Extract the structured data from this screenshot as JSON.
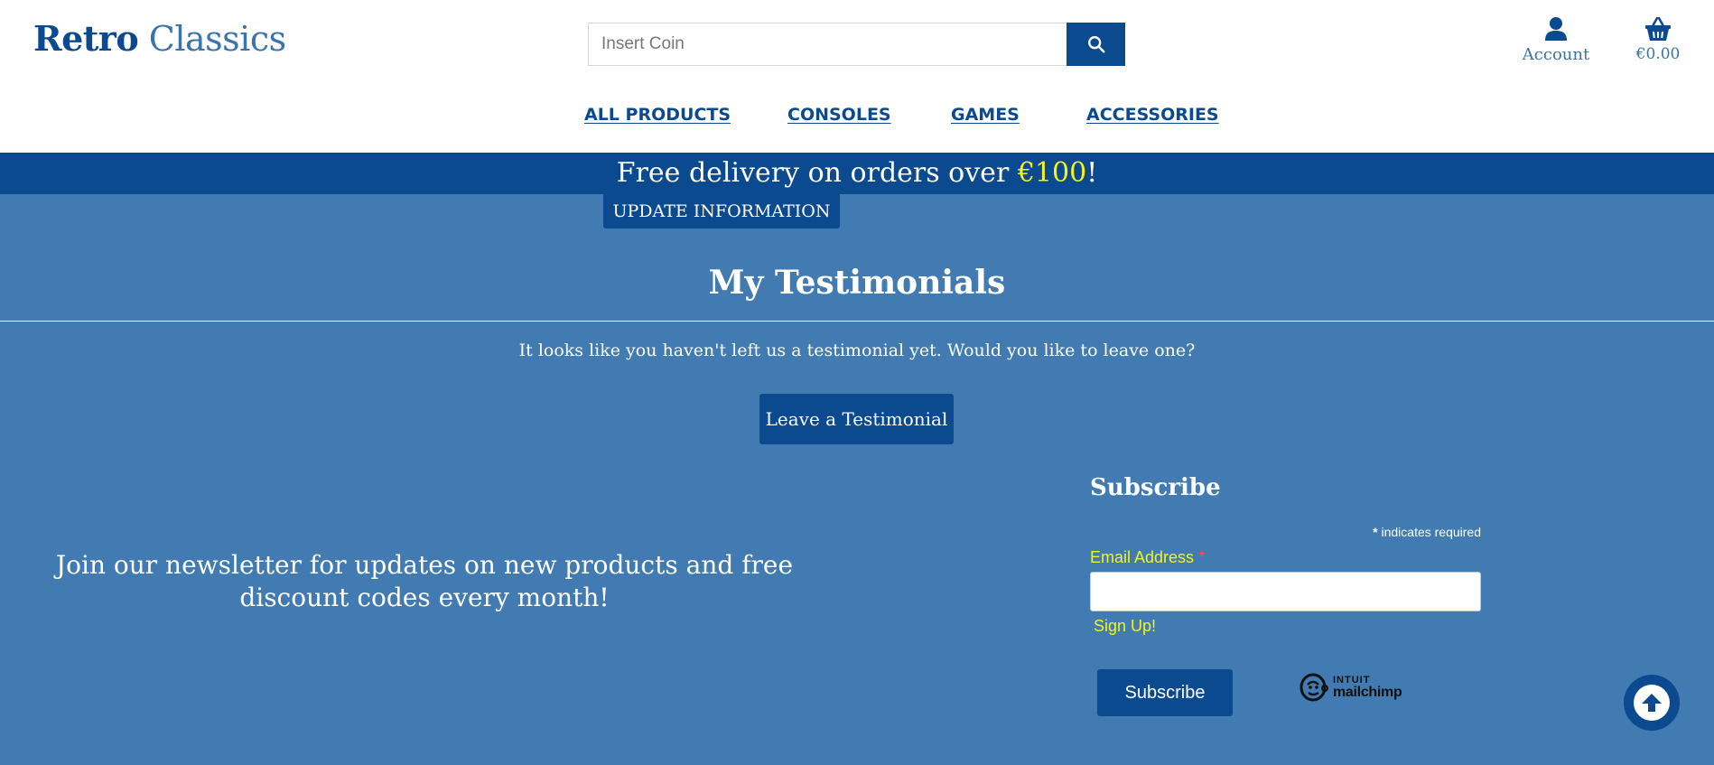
{
  "header": {
    "logo_bold": "Retro",
    "logo_light": "Classics",
    "search_placeholder": "Insert Coin",
    "account_label": "Account",
    "cart_total": "€0.00"
  },
  "nav": {
    "items": [
      {
        "label": "ALL PRODUCTS"
      },
      {
        "label": "CONSOLES"
      },
      {
        "label": "GAMES"
      },
      {
        "label": "ACCESSORIES"
      }
    ]
  },
  "banner": {
    "prefix": "Free delivery on orders over ",
    "amount": "€100",
    "suffix": "!"
  },
  "profile": {
    "update_button": "UPDATE INFORMATION"
  },
  "testimonials": {
    "title": "My Testimonials",
    "notice": "It looks like you haven't left us a testimonial yet. Would you like to leave one?",
    "button": "Leave a Testimonial"
  },
  "newsletter": {
    "text": "Join our newsletter for updates on new products and free discount codes every month!",
    "subscribe_title": "Subscribe",
    "required_star": "*",
    "required_note": " indicates required",
    "email_label": "Email Address ",
    "email_star": "*",
    "signup_text": "Sign Up!",
    "subscribe_button": "Subscribe",
    "mailchimp_top": "INTUIT",
    "mailchimp_bottom": "mailchimp"
  },
  "colors": {
    "brand_dark": "#0b4a8f",
    "page_bg": "#417bb1",
    "highlight": "#f4f21f"
  },
  "icons": [
    "search-icon",
    "user-icon",
    "basket-icon",
    "mailchimp-logo-icon",
    "arrow-up-icon"
  ]
}
